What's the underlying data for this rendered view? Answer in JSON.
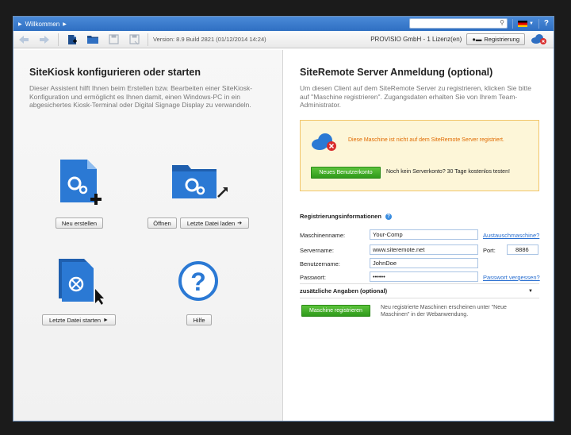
{
  "titlebar": {
    "breadcrumb": "Willkommen",
    "search_placeholder": "",
    "help_label": "?"
  },
  "toolbar": {
    "version": "Version: 8.9 Build 2821 (01/12/2014 14:24)",
    "company": "PROVISIO GmbH - 1 Lizenz(en)",
    "register_label": "Registrierung"
  },
  "left": {
    "title": "SiteKiosk konfigurieren oder starten",
    "intro": "Dieser Assistent hilft Ihnen beim Erstellen bzw. Bearbeiten einer SiteKiosk-Konfiguration und ermöglicht es Ihnen damit, einen Windows-PC in ein abgesichertes Kiosk-Terminal oder Digital Signage Display zu verwandeln.",
    "new_label": "Neu erstellen",
    "open_label": "Öffnen",
    "load_last_label": "Letzte Datei laden",
    "start_last_label": "Letzte Datei starten",
    "help_label": "Hilfe"
  },
  "right": {
    "title": "SiteRemote Server Anmeldung (optional)",
    "intro": "Um diesen Client auf dem SiteRemote Server zu registrieren, klicken Sie bitte auf \"Maschine registrieren\". Zugangsdaten erhalten Sie von Ihrem Team-Administrator.",
    "warning": "Diese Maschine ist nicht auf dem SiteRemote Server registriert.",
    "new_account_label": "Neues Benutzerkonto",
    "trial_text": "Noch kein Serverkonto? 30 Tage kostenlos testen!",
    "reg_info_label": "Registrierungsinformationen",
    "form": {
      "machine_label": "Maschinenname:",
      "machine_value": "Your-Comp",
      "exchange_link": "Austauschmaschine?",
      "server_label": "Servername:",
      "server_value": "www.siteremote.net",
      "port_label": "Port:",
      "port_value": "8886",
      "user_label": "Benutzername:",
      "user_value": "JohnDoe",
      "password_label": "Passwort:",
      "password_value": "••••••",
      "forgot_link": "Passwort vergessen?"
    },
    "extra_label": "zusätzliche Angaben (optional)",
    "register_machine_label": "Maschine registrieren",
    "register_note": "Neu registrierte Maschinen erscheinen unter \"Neue Maschinen\" in der Webanwendung."
  },
  "colors": {
    "accent_blue": "#2f6fc2",
    "green_button": "#3aa523",
    "warning_orange": "#e06a00",
    "notice_bg": "#fdf6d8"
  }
}
